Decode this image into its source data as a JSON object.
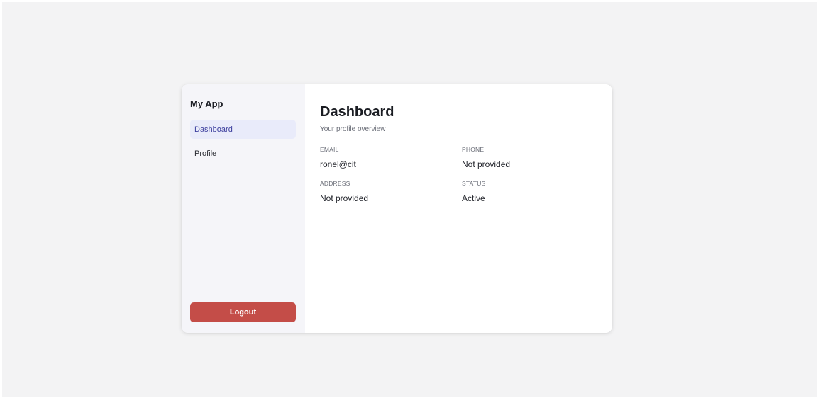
{
  "sidebar": {
    "app_title": "My App",
    "items": [
      {
        "label": "Dashboard",
        "active": true
      },
      {
        "label": "Profile",
        "active": false
      }
    ],
    "logout_label": "Logout"
  },
  "main": {
    "title": "Dashboard",
    "subtitle": "Your profile overview",
    "fields": [
      {
        "label": "EMAIL",
        "value": "ronel@cit"
      },
      {
        "label": "PHONE",
        "value": "Not provided"
      },
      {
        "label": "ADDRESS",
        "value": "Not provided"
      },
      {
        "label": "STATUS",
        "value": "Active"
      }
    ]
  },
  "colors": {
    "page_background": "#f3f3f4",
    "sidebar_background": "#f5f5f9",
    "active_nav_background": "#e9ebfa",
    "active_nav_text": "#3d3f9e",
    "logout_button": "#c44d48"
  }
}
